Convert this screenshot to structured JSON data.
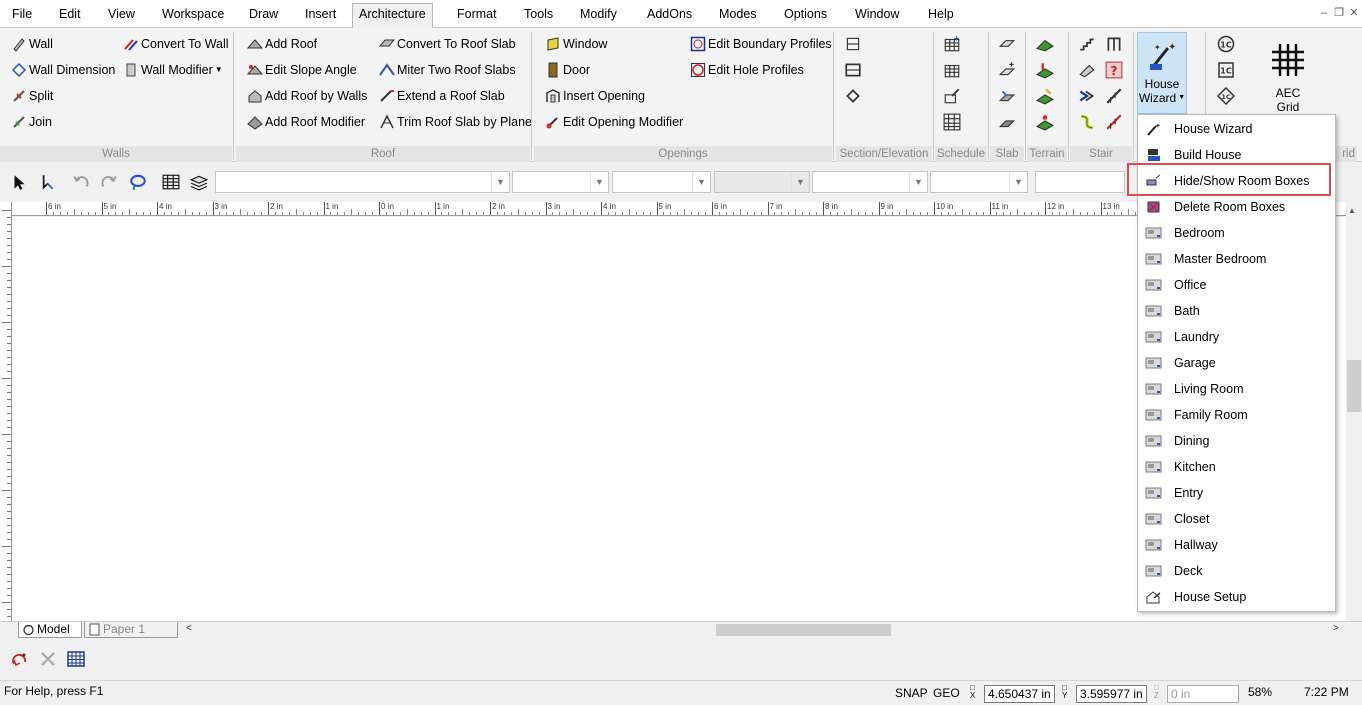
{
  "menubar": {
    "items": [
      "File",
      "Edit",
      "View",
      "Workspace",
      "Draw",
      "Insert",
      "Architecture",
      "Format",
      "Tools",
      "Modify",
      "AddOns",
      "Modes",
      "Options",
      "Window",
      "Help"
    ],
    "active": "Architecture"
  },
  "ribbon": {
    "walls": {
      "wall": "Wall",
      "convert_to_wall": "Convert To Wall",
      "wall_dimension": "Wall Dimension",
      "wall_modifier": "Wall Modifier",
      "split": "Split",
      "join": "Join",
      "label": "Walls"
    },
    "roof": {
      "add_roof": "Add Roof",
      "edit_slope_angle": "Edit Slope Angle",
      "add_roof_by_walls": "Add Roof by Walls",
      "add_roof_modifier": "Add Roof Modifier",
      "convert_to_roof_slab": "Convert To Roof Slab",
      "miter_two_roof_slabs": "Miter Two Roof Slabs",
      "extend_a_roof_slab": "Extend a Roof Slab",
      "trim_roof_slab_by_plane": "Trim Roof Slab by Plane",
      "label": "Roof"
    },
    "openings": {
      "window": "Window",
      "door": "Door",
      "insert_opening": "Insert Opening",
      "edit_opening_modifier": "Edit Opening Modifier",
      "edit_boundary_profiles": "Edit Boundary Profiles",
      "edit_hole_profiles": "Edit Hole Profiles",
      "label": "Openings"
    },
    "section_label": "Section/Elevation",
    "schedule_label": "Schedule",
    "slab_label": "Slab",
    "terrain_label": "Terrain",
    "stair_label": "Stair",
    "grid_label_partial": "rid",
    "house_wizard": {
      "line1": "House",
      "line2": "Wizard"
    },
    "aec_grid": {
      "line1": "AEC",
      "line2": "Grid"
    }
  },
  "ruler": {
    "labels": [
      "6 in",
      "5 in",
      "4 in",
      "3 in",
      "2 in",
      "1 in",
      "0 in",
      "1 in",
      "2 in",
      "3 in",
      "4 in",
      "5 in",
      "6 in",
      "7 in",
      "8 in",
      "9 in",
      "10 in",
      "11 in",
      "12 in",
      "13 in"
    ]
  },
  "tabs": {
    "model": "Model",
    "paper1": "Paper 1"
  },
  "status": {
    "help": "For Help, press F1",
    "snap": "SNAP",
    "geo": "GEO",
    "x_label": "X",
    "y_label": "Y",
    "z_label": "Z",
    "x_value": "4.650437 in",
    "y_value": "3.595977 in",
    "z_value": "0 in",
    "zoom": "58%",
    "time": "7:22 PM"
  },
  "house_wizard_menu": {
    "items": [
      "House Wizard",
      "Build House",
      "Hide/Show Room Boxes",
      "Delete Room Boxes",
      "Bedroom",
      "Master Bedroom",
      "Office",
      "Bath",
      "Laundry",
      "Garage",
      "Living Room",
      "Family Room",
      "Dining",
      "Kitchen",
      "Entry",
      "Closet",
      "Hallway",
      "Deck",
      "House Setup"
    ],
    "highlighted": "Hide/Show Room Boxes"
  },
  "colors": {
    "accent": "#cde4f7",
    "highlight": "#e34a4a"
  }
}
